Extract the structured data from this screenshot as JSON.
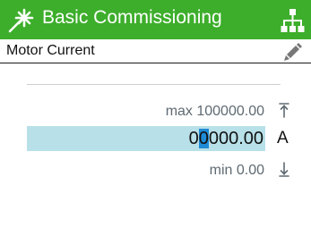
{
  "header": {
    "title": "Basic Commissioning",
    "wizard_icon": "wizard-wand-icon",
    "hierarchy_icon": "hierarchy-icon",
    "background_color": "#3dae2b"
  },
  "parameter": {
    "name": "Motor Current",
    "edit_icon": "pencil-icon"
  },
  "value_editor": {
    "max_label": "max 100000.00",
    "value_before_cursor": "0",
    "value_cursor_char": "0",
    "value_after_cursor": "000.00",
    "unit": "A",
    "min_label": "min 0.00",
    "field_color": "#b8e0e8",
    "cursor_color": "#1f8ad6"
  }
}
